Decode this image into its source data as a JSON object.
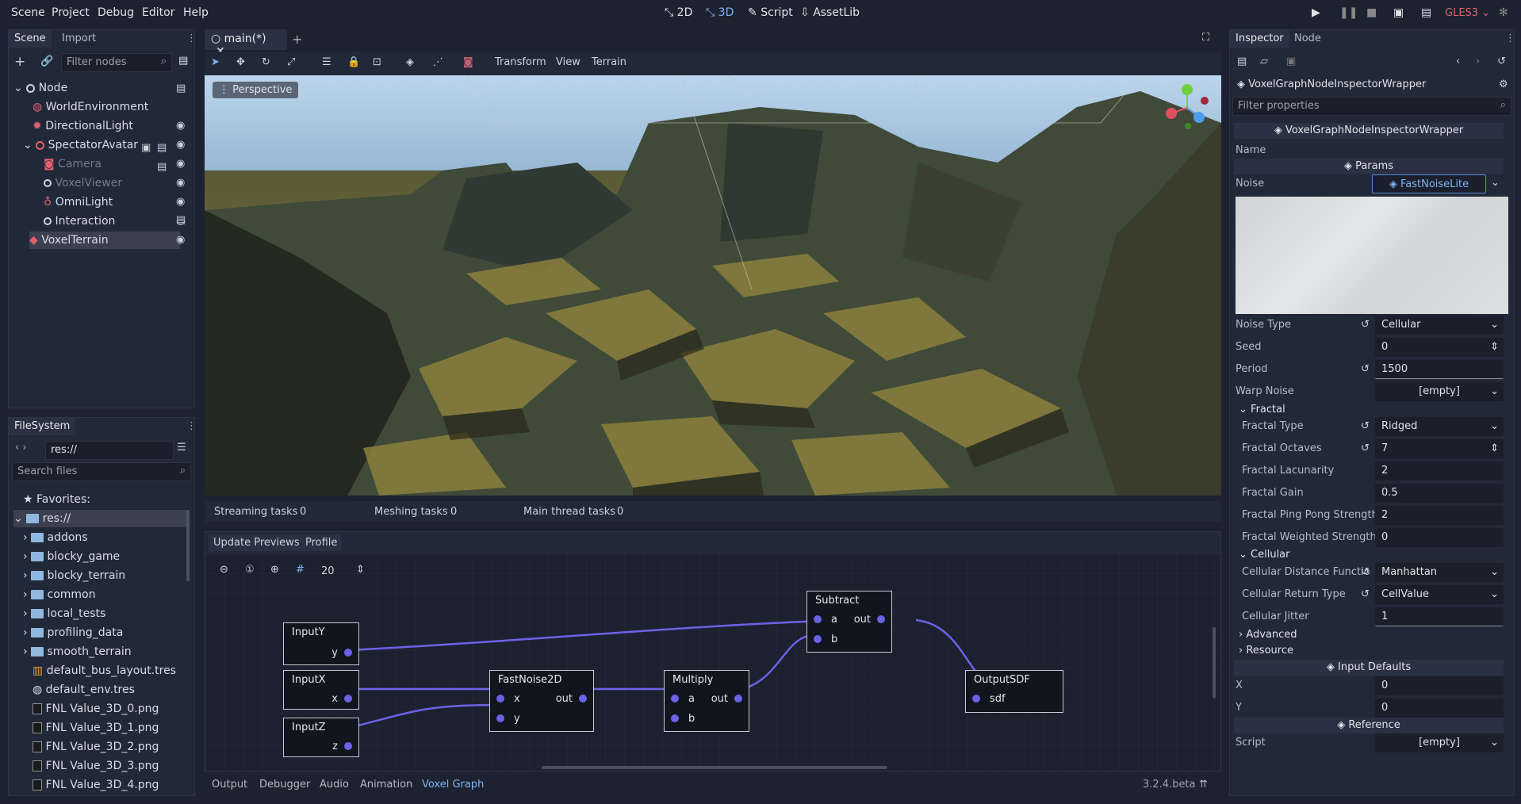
{
  "menu": {
    "items": [
      "Scene",
      "Project",
      "Debug",
      "Editor",
      "Help"
    ],
    "workspaces": [
      "2D",
      "3D",
      "Script",
      "AssetLib"
    ],
    "renderer": "GLES3"
  },
  "scene_dock": {
    "tabs": [
      "Scene",
      "Import"
    ],
    "filter_placeholder": "Filter nodes",
    "nodes": [
      {
        "label": "Node"
      },
      {
        "label": "WorldEnvironment"
      },
      {
        "label": "DirectionalLight"
      },
      {
        "label": "SpectatorAvatar"
      },
      {
        "label": "Camera"
      },
      {
        "label": "VoxelViewer"
      },
      {
        "label": "OmniLight"
      },
      {
        "label": "Interaction"
      },
      {
        "label": "VoxelTerrain"
      }
    ]
  },
  "filesystem": {
    "tab": "FileSystem",
    "path": "res://",
    "search_placeholder": "Search files",
    "favorites": "Favorites:",
    "items": [
      "res://",
      "addons",
      "blocky_game",
      "blocky_terrain",
      "common",
      "local_tests",
      "profiling_data",
      "smooth_terrain",
      "default_bus_layout.tres",
      "default_env.tres",
      "FNL Value_3D_0.png",
      "FNL Value_3D_1.png",
      "FNL Value_3D_2.png",
      "FNL Value_3D_3.png",
      "FNL Value_3D_4.png"
    ]
  },
  "editor_tab": {
    "label": "main(*)"
  },
  "viewport_menu": {
    "transform": "Transform",
    "view": "View",
    "terrain": "Terrain",
    "perspective": "Perspective"
  },
  "stats": {
    "streaming_label": "Streaming tasks",
    "streaming": "0",
    "meshing_label": "Meshing tasks",
    "meshing": "0",
    "main_label": "Main thread tasks",
    "main": "0"
  },
  "graph": {
    "tabs": [
      "Update Previews",
      "Profile"
    ],
    "zoom": "20",
    "nodes": {
      "inputy": {
        "title": "InputY",
        "port": "y"
      },
      "inputx": {
        "title": "InputX",
        "port": "x"
      },
      "inputz": {
        "title": "InputZ",
        "port": "z"
      },
      "noise": {
        "title": "FastNoise2D",
        "in1": "x",
        "in2": "y",
        "out": "out"
      },
      "multiply": {
        "title": "Multiply",
        "in1": "a",
        "in2": "b",
        "out": "out"
      },
      "subtract": {
        "title": "Subtract",
        "in1": "a",
        "in2": "b",
        "out": "out"
      },
      "output": {
        "title": "OutputSDF",
        "in1": "sdf"
      }
    }
  },
  "bottom": {
    "tabs": [
      "Output",
      "Debugger",
      "Audio",
      "Animation",
      "Voxel Graph"
    ],
    "version": "3.2.4.beta"
  },
  "inspector": {
    "tabs": [
      "Inspector",
      "Node"
    ],
    "object": "VoxelGraphNodeInspectorWrapper",
    "filter_placeholder": "Filter properties",
    "header": "VoxelGraphNodeInspectorWrapper",
    "name_label": "Name",
    "params": "Params",
    "noise_label": "Noise",
    "noise_value": "FastNoiseLite",
    "props": {
      "noise_type": [
        "Noise Type",
        "Cellular"
      ],
      "seed": [
        "Seed",
        "0"
      ],
      "period": [
        "Period",
        "1500"
      ],
      "warp": [
        "Warp Noise",
        "[empty]"
      ],
      "fractal": "Fractal",
      "fractal_type": [
        "Fractal Type",
        "Ridged"
      ],
      "octaves": [
        "Fractal Octaves",
        "7"
      ],
      "lacunarity": [
        "Fractal Lacunarity",
        "2"
      ],
      "gain": [
        "Fractal Gain",
        "0.5"
      ],
      "pingpong": [
        "Fractal Ping Pong Strength",
        "2"
      ],
      "weighted": [
        "Fractal Weighted Strength",
        "0"
      ],
      "cellular": "Cellular",
      "cdist": [
        "Cellular Distance Functio",
        "Manhattan"
      ],
      "cret": [
        "Cellular Return Type",
        "CellValue"
      ],
      "cjit": [
        "Cellular Jitter",
        "1"
      ],
      "advanced": "Advanced",
      "resource": "Resource"
    },
    "input_defaults": "Input Defaults",
    "x": [
      "X",
      "0"
    ],
    "y": [
      "Y",
      "0"
    ],
    "reference": "Reference",
    "script": [
      "Script",
      "[empty]"
    ]
  }
}
